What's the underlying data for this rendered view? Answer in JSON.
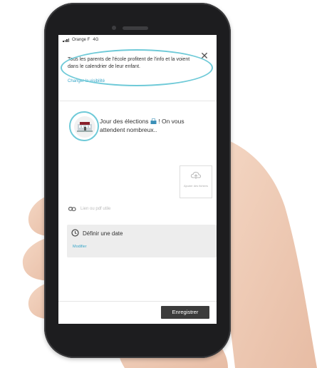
{
  "status_bar": {
    "carrier": "Orange F",
    "network": "4G"
  },
  "notice": {
    "text": "Tous les parents de l'école profitent de l'info et la voient dans le calendrier de leur enfant.",
    "change_link": "Changer la visibilité"
  },
  "post": {
    "message_part1": "Jour des élections ",
    "message_part2": " ! On vous attendent nombreux..",
    "emoji": "ballot-box-emoji"
  },
  "add_photo": {
    "label": "Ajouter des fichiers"
  },
  "attachment": {
    "label": "Lien ou pdf utile"
  },
  "date": {
    "label": "Définir une date",
    "modify_link": "Modifier"
  },
  "save_button": "Enregistrer",
  "colors": {
    "highlight_ring": "#6fcad8",
    "link": "#3aa7c9",
    "save_button_bg": "#3c3c3c",
    "phone_body": "#1d1d1f"
  }
}
